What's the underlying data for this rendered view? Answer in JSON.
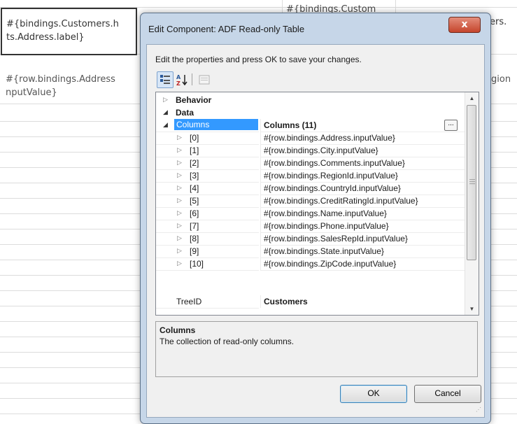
{
  "background": {
    "header_cell_text": [
      "#{bindings.Customers.h",
      "ts.Address.label}"
    ],
    "header_cell2_text": "#{bindings.Custom",
    "right_cell_text": "ers.",
    "row_value_text": [
      "#{row.bindings.Address",
      "nputValue}"
    ],
    "right_row_text": "gion"
  },
  "dialog": {
    "title": "Edit Component: ADF Read-only Table",
    "close_label": "x",
    "instruction": "Edit the properties and press OK to save your changes.",
    "toolbar": {
      "categorized_icon": "categorized-icon",
      "sort_icon": "sort-az-icon",
      "property_pages_icon": "property-pages-icon"
    },
    "properties": {
      "behavior_label": "Behavior",
      "data_label": "Data",
      "columns_label": "Columns",
      "columns_value": "Columns (11)",
      "ellipsis": "...",
      "columns": [
        {
          "index": "[0]",
          "value": "#{row.bindings.Address.inputValue}"
        },
        {
          "index": "[1]",
          "value": "#{row.bindings.City.inputValue}"
        },
        {
          "index": "[2]",
          "value": "#{row.bindings.Comments.inputValue}"
        },
        {
          "index": "[3]",
          "value": "#{row.bindings.RegionId.inputValue}"
        },
        {
          "index": "[4]",
          "value": "#{row.bindings.CountryId.inputValue}"
        },
        {
          "index": "[5]",
          "value": "#{row.bindings.CreditRatingId.inputValue}"
        },
        {
          "index": "[6]",
          "value": "#{row.bindings.Name.inputValue}"
        },
        {
          "index": "[7]",
          "value": "#{row.bindings.Phone.inputValue}"
        },
        {
          "index": "[8]",
          "value": "#{row.bindings.SalesRepId.inputValue}"
        },
        {
          "index": "[9]",
          "value": "#{row.bindings.State.inputValue}"
        },
        {
          "index": "[10]",
          "value": "#{row.bindings.ZipCode.inputValue}"
        }
      ],
      "treeid_label": "TreeID",
      "treeid_value": "Customers"
    },
    "description": {
      "title": "Columns",
      "text": "The collection of read-only columns."
    },
    "ok_label": "OK",
    "cancel_label": "Cancel"
  }
}
